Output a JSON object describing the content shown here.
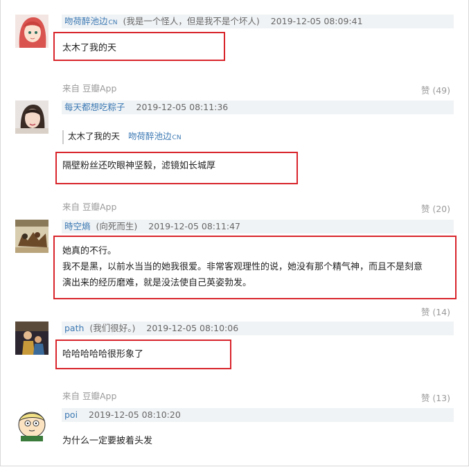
{
  "comments": [
    {
      "user": "吻荷醉池边",
      "badge": "CN",
      "signature": "(我是一个怪人，但是我不是个坏人)",
      "time": "2019-12-05 08:09:41",
      "content": "太木了我的天",
      "source": "来自 豆瓣App",
      "likes": "赞 (49)"
    },
    {
      "user": "每天都想吃粽子",
      "time": "2019-12-05 08:11:36",
      "quote_text": "太木了我的天",
      "quote_user": "吻荷醉池边",
      "quote_badge": "CN",
      "content": "隔壁粉丝还吹眼神坚毅，滤镜如长城厚",
      "source": "来自 豆瓣App",
      "likes": "赞 (20)"
    },
    {
      "user": "時空熵",
      "signature": "(向死而生)",
      "time": "2019-12-05 08:11:47",
      "content_lines": [
        "她真的不行。",
        "我不是黑，以前水当当的她我很爱。非常客观理性的说，她没有那个精气神，而且不是刻意",
        "演出来的经历磨难，就是没法使自己英姿勃发。"
      ],
      "likes": "赞 (14)"
    },
    {
      "user": "path",
      "signature": "(我们很好。)",
      "time": "2019-12-05 08:10:06",
      "content": "哈哈哈哈哈很形象了",
      "source": "来自 豆瓣App",
      "likes": "赞 (13)"
    },
    {
      "user": "poi",
      "time": "2019-12-05 08:10:20",
      "content": "为什么一定要披着头发"
    }
  ],
  "colors": {
    "highlight": "#d8232a",
    "username": "#3b78b3",
    "meta_bg": "#f0f3f5"
  }
}
